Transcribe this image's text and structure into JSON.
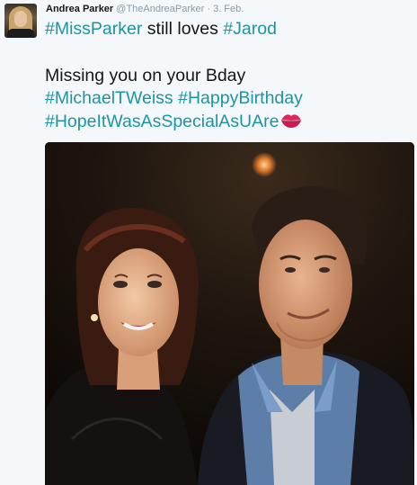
{
  "tweet": {
    "author_name": "Andrea Parker",
    "author_handle": "@TheAndreaParker",
    "separator": "·",
    "date": "3. Feb.",
    "line1": {
      "tag1": "#MissParker",
      "text": " still loves ",
      "tag2": "#Jarod"
    },
    "line2": "Missing you on your Bday",
    "line3": {
      "tag1": "#MichaelTWeiss",
      "tag2": "#HappyBirthday"
    },
    "line4": {
      "tag": "#HopeItWasAsSpecialAsUAre",
      "emoji": "kiss-mark-icon"
    },
    "colors": {
      "hashtag": "#1b95a3",
      "text": "#14171a",
      "meta": "#8899a6",
      "background": "#f5f8fa"
    }
  }
}
